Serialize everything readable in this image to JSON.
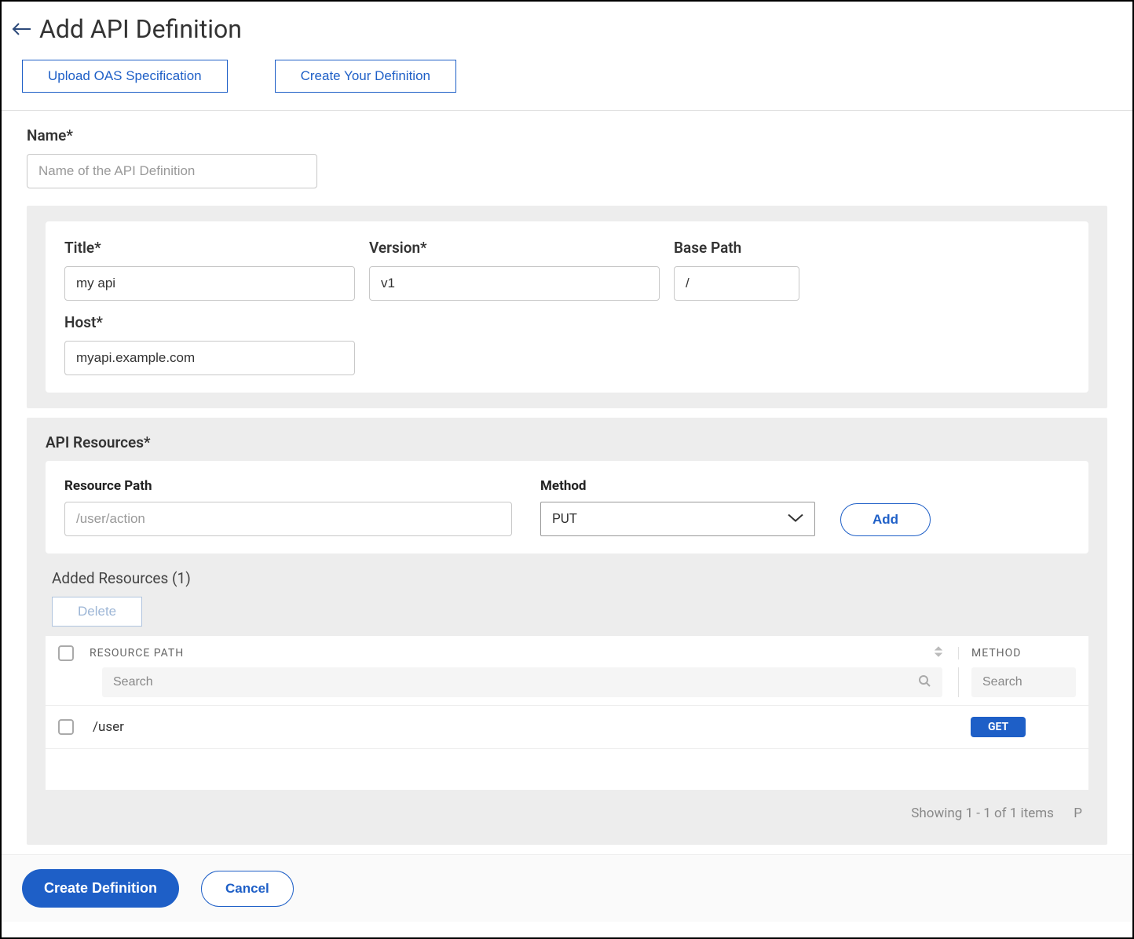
{
  "header": {
    "title": "Add API Definition"
  },
  "tabs": {
    "upload": "Upload OAS Specification",
    "create": "Create Your Definition"
  },
  "name_section": {
    "label": "Name*",
    "placeholder": "Name of the API Definition",
    "value": ""
  },
  "details": {
    "title_label": "Title*",
    "title_value": "my api",
    "version_label": "Version*",
    "version_value": "v1",
    "basepath_label": "Base Path",
    "basepath_value": "/",
    "host_label": "Host*",
    "host_value": "myapi.example.com"
  },
  "resources": {
    "section_title": "API Resources*",
    "path_label": "Resource Path",
    "path_placeholder": "/user/action",
    "path_value": "",
    "method_label": "Method",
    "method_value": "PUT",
    "add_label": "Add"
  },
  "added": {
    "title": "Added Resources (1)",
    "delete_label": "Delete",
    "col_path": "RESOURCE PATH",
    "col_method": "METHOD",
    "search_placeholder": "Search",
    "rows": [
      {
        "path": "/user",
        "method": "GET"
      }
    ],
    "footer": "Showing 1 - 1 of 1 items",
    "page_fragment": "P"
  },
  "footer": {
    "create": "Create Definition",
    "cancel": "Cancel"
  }
}
